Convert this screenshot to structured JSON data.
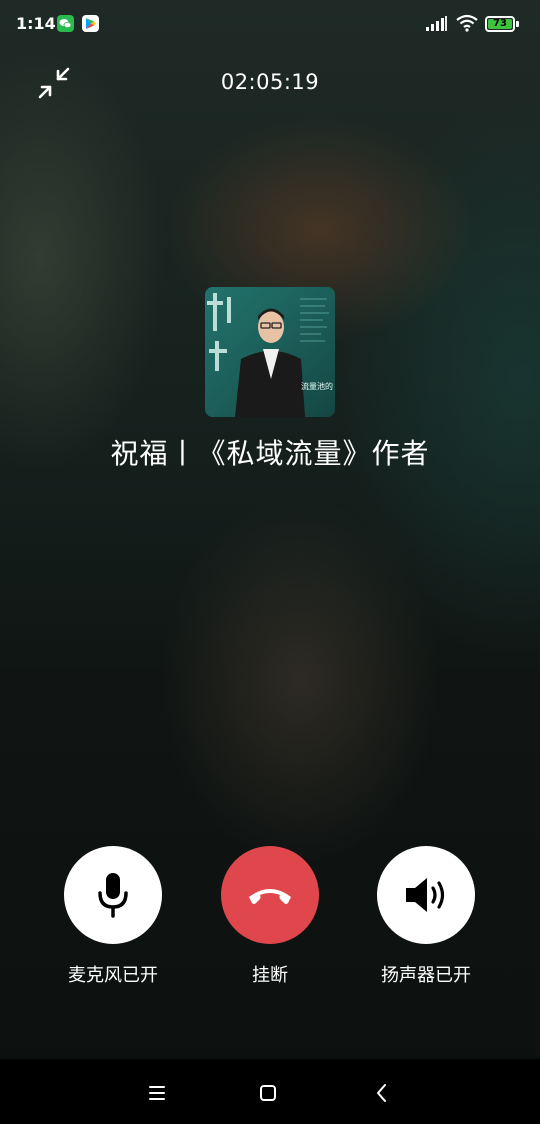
{
  "status_bar": {
    "time": "1:14",
    "battery_level": "73",
    "notification_icons": [
      "wechat-icon",
      "google-play-icon"
    ],
    "system_icons": [
      "signal-icon",
      "wifi-icon",
      "battery-icon"
    ]
  },
  "call": {
    "duration": "02:05:19",
    "contact_name": "祝福丨《私域流量》作者"
  },
  "controls": {
    "microphone_label": "麦克风已开",
    "hangup_label": "挂断",
    "speaker_label": "扬声器已开"
  },
  "colors": {
    "hangup": "#e0474c",
    "control_bg": "#ffffff",
    "battery": "#3ec43e"
  },
  "nav_icons": [
    "menu-icon",
    "home-icon",
    "back-icon"
  ]
}
